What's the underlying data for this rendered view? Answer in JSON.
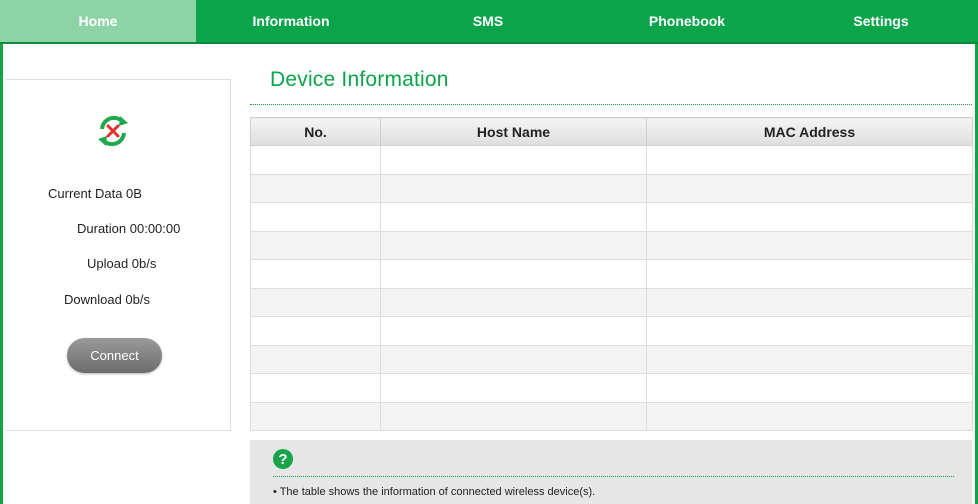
{
  "nav": {
    "items": [
      {
        "label": "Home",
        "active": true
      },
      {
        "label": "Information",
        "active": false
      },
      {
        "label": "SMS",
        "active": false
      },
      {
        "label": "Phonebook",
        "active": false
      },
      {
        "label": "Settings",
        "active": false
      }
    ]
  },
  "status": {
    "icon": "disconnected-sync-icon",
    "current_data": "Current Data 0B",
    "duration": "Duration 00:00:00",
    "upload": "Upload 0b/s",
    "download": "Download 0b/s",
    "connect_label": "Connect"
  },
  "main": {
    "title": "Device Information",
    "table": {
      "columns": [
        "No.",
        "Host Name",
        "MAC Address"
      ],
      "rows": [
        [
          "",
          "",
          ""
        ],
        [
          "",
          "",
          ""
        ],
        [
          "",
          "",
          ""
        ],
        [
          "",
          "",
          ""
        ],
        [
          "",
          "",
          ""
        ],
        [
          "",
          "",
          ""
        ],
        [
          "",
          "",
          ""
        ],
        [
          "",
          "",
          ""
        ],
        [
          "",
          "",
          ""
        ],
        [
          "",
          "",
          ""
        ]
      ]
    }
  },
  "help": {
    "icon": "help-icon",
    "icon_glyph": "?",
    "text": "• The table shows the information of connected wireless device(s)."
  },
  "colors": {
    "accent": "#0aa54a",
    "nav_active": "#8ed3a5"
  }
}
